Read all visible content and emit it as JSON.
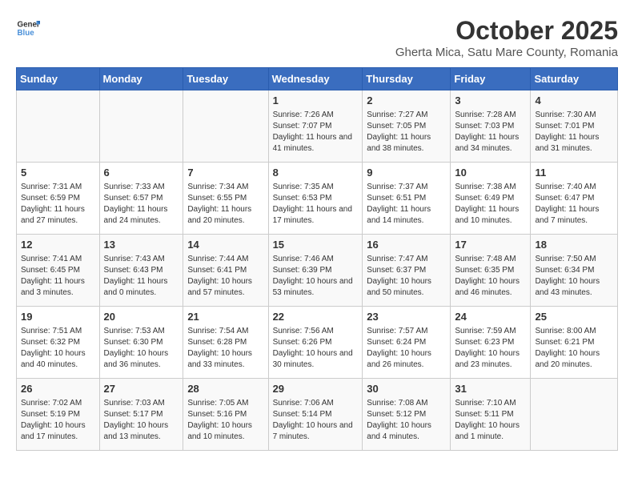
{
  "header": {
    "logo_general": "General",
    "logo_blue": "Blue",
    "title": "October 2025",
    "subtitle": "Gherta Mica, Satu Mare County, Romania"
  },
  "weekdays": [
    "Sunday",
    "Monday",
    "Tuesday",
    "Wednesday",
    "Thursday",
    "Friday",
    "Saturday"
  ],
  "weeks": [
    [
      {
        "day": "",
        "info": ""
      },
      {
        "day": "",
        "info": ""
      },
      {
        "day": "",
        "info": ""
      },
      {
        "day": "1",
        "info": "Sunrise: 7:26 AM\nSunset: 7:07 PM\nDaylight: 11 hours and 41 minutes."
      },
      {
        "day": "2",
        "info": "Sunrise: 7:27 AM\nSunset: 7:05 PM\nDaylight: 11 hours and 38 minutes."
      },
      {
        "day": "3",
        "info": "Sunrise: 7:28 AM\nSunset: 7:03 PM\nDaylight: 11 hours and 34 minutes."
      },
      {
        "day": "4",
        "info": "Sunrise: 7:30 AM\nSunset: 7:01 PM\nDaylight: 11 hours and 31 minutes."
      }
    ],
    [
      {
        "day": "5",
        "info": "Sunrise: 7:31 AM\nSunset: 6:59 PM\nDaylight: 11 hours and 27 minutes."
      },
      {
        "day": "6",
        "info": "Sunrise: 7:33 AM\nSunset: 6:57 PM\nDaylight: 11 hours and 24 minutes."
      },
      {
        "day": "7",
        "info": "Sunrise: 7:34 AM\nSunset: 6:55 PM\nDaylight: 11 hours and 20 minutes."
      },
      {
        "day": "8",
        "info": "Sunrise: 7:35 AM\nSunset: 6:53 PM\nDaylight: 11 hours and 17 minutes."
      },
      {
        "day": "9",
        "info": "Sunrise: 7:37 AM\nSunset: 6:51 PM\nDaylight: 11 hours and 14 minutes."
      },
      {
        "day": "10",
        "info": "Sunrise: 7:38 AM\nSunset: 6:49 PM\nDaylight: 11 hours and 10 minutes."
      },
      {
        "day": "11",
        "info": "Sunrise: 7:40 AM\nSunset: 6:47 PM\nDaylight: 11 hours and 7 minutes."
      }
    ],
    [
      {
        "day": "12",
        "info": "Sunrise: 7:41 AM\nSunset: 6:45 PM\nDaylight: 11 hours and 3 minutes."
      },
      {
        "day": "13",
        "info": "Sunrise: 7:43 AM\nSunset: 6:43 PM\nDaylight: 11 hours and 0 minutes."
      },
      {
        "day": "14",
        "info": "Sunrise: 7:44 AM\nSunset: 6:41 PM\nDaylight: 10 hours and 57 minutes."
      },
      {
        "day": "15",
        "info": "Sunrise: 7:46 AM\nSunset: 6:39 PM\nDaylight: 10 hours and 53 minutes."
      },
      {
        "day": "16",
        "info": "Sunrise: 7:47 AM\nSunset: 6:37 PM\nDaylight: 10 hours and 50 minutes."
      },
      {
        "day": "17",
        "info": "Sunrise: 7:48 AM\nSunset: 6:35 PM\nDaylight: 10 hours and 46 minutes."
      },
      {
        "day": "18",
        "info": "Sunrise: 7:50 AM\nSunset: 6:34 PM\nDaylight: 10 hours and 43 minutes."
      }
    ],
    [
      {
        "day": "19",
        "info": "Sunrise: 7:51 AM\nSunset: 6:32 PM\nDaylight: 10 hours and 40 minutes."
      },
      {
        "day": "20",
        "info": "Sunrise: 7:53 AM\nSunset: 6:30 PM\nDaylight: 10 hours and 36 minutes."
      },
      {
        "day": "21",
        "info": "Sunrise: 7:54 AM\nSunset: 6:28 PM\nDaylight: 10 hours and 33 minutes."
      },
      {
        "day": "22",
        "info": "Sunrise: 7:56 AM\nSunset: 6:26 PM\nDaylight: 10 hours and 30 minutes."
      },
      {
        "day": "23",
        "info": "Sunrise: 7:57 AM\nSunset: 6:24 PM\nDaylight: 10 hours and 26 minutes."
      },
      {
        "day": "24",
        "info": "Sunrise: 7:59 AM\nSunset: 6:23 PM\nDaylight: 10 hours and 23 minutes."
      },
      {
        "day": "25",
        "info": "Sunrise: 8:00 AM\nSunset: 6:21 PM\nDaylight: 10 hours and 20 minutes."
      }
    ],
    [
      {
        "day": "26",
        "info": "Sunrise: 7:02 AM\nSunset: 5:19 PM\nDaylight: 10 hours and 17 minutes."
      },
      {
        "day": "27",
        "info": "Sunrise: 7:03 AM\nSunset: 5:17 PM\nDaylight: 10 hours and 13 minutes."
      },
      {
        "day": "28",
        "info": "Sunrise: 7:05 AM\nSunset: 5:16 PM\nDaylight: 10 hours and 10 minutes."
      },
      {
        "day": "29",
        "info": "Sunrise: 7:06 AM\nSunset: 5:14 PM\nDaylight: 10 hours and 7 minutes."
      },
      {
        "day": "30",
        "info": "Sunrise: 7:08 AM\nSunset: 5:12 PM\nDaylight: 10 hours and 4 minutes."
      },
      {
        "day": "31",
        "info": "Sunrise: 7:10 AM\nSunset: 5:11 PM\nDaylight: 10 hours and 1 minute."
      },
      {
        "day": "",
        "info": ""
      }
    ]
  ]
}
